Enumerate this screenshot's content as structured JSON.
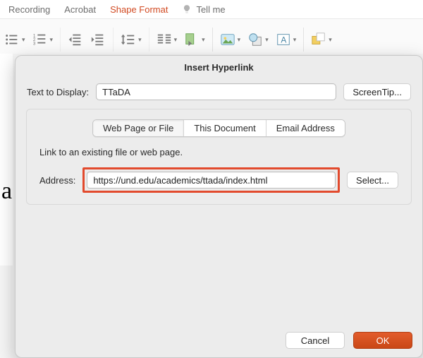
{
  "ribbon": {
    "tabs": {
      "recording": "Recording",
      "acrobat": "Acrobat",
      "shape_format": "Shape Format",
      "tell_me": "Tell me"
    }
  },
  "dialog": {
    "title": "Insert Hyperlink",
    "text_to_display_label": "Text to Display:",
    "text_to_display_value": "TTaDA",
    "screentip_button": "ScreenTip...",
    "segments": {
      "web": "Web Page or File",
      "this_doc": "This Document",
      "email": "Email Address"
    },
    "hint": "Link to an existing file or web page.",
    "address_label": "Address:",
    "address_value": "https://und.edu/academics/ttada/index.html",
    "select_button": "Select...",
    "cancel": "Cancel",
    "ok": "OK"
  },
  "doc": {
    "glyph": "a"
  }
}
